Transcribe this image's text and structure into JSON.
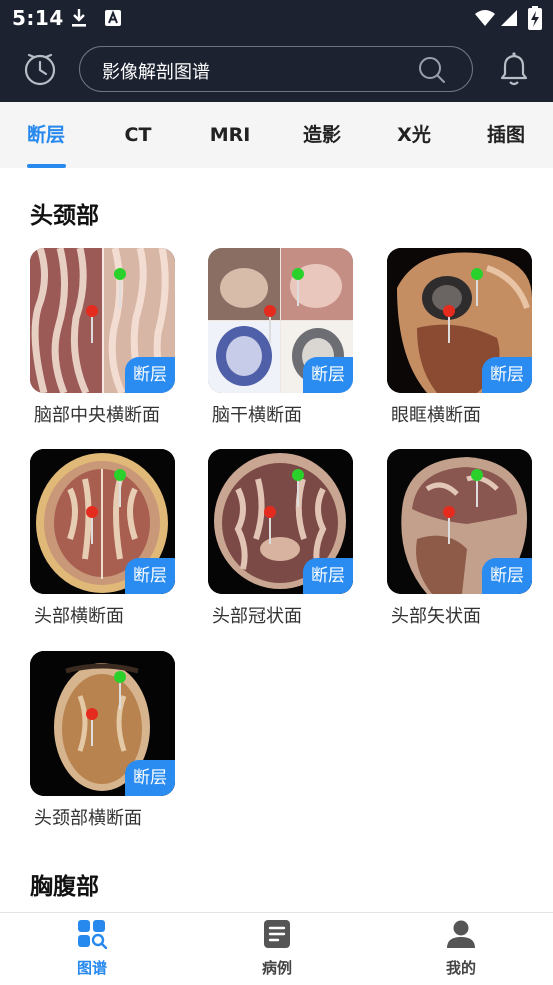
{
  "status_bar": {
    "time": "5:14"
  },
  "header": {
    "search_placeholder": "影像解剖图谱"
  },
  "tabs": [
    {
      "label": "断层",
      "active": true
    },
    {
      "label": "CT"
    },
    {
      "label": "MRI"
    },
    {
      "label": "造影"
    },
    {
      "label": "X光"
    },
    {
      "label": "插图"
    }
  ],
  "sections": [
    {
      "title": "头颈部",
      "items": [
        {
          "caption": "脑部中央横断面",
          "badge": "断层"
        },
        {
          "caption": "脑干横断面",
          "badge": "断层"
        },
        {
          "caption": "眼眶横断面",
          "badge": "断层"
        },
        {
          "caption": "头部横断面",
          "badge": "断层"
        },
        {
          "caption": "头部冠状面",
          "badge": "断层"
        },
        {
          "caption": "头部矢状面",
          "badge": "断层"
        },
        {
          "caption": "头颈部横断面",
          "badge": "断层"
        }
      ]
    },
    {
      "title": "胸腹部"
    }
  ],
  "bottom_nav": [
    {
      "label": "图谱",
      "icon": "atlas-icon",
      "active": true
    },
    {
      "label": "病例",
      "icon": "case-icon"
    },
    {
      "label": "我的",
      "icon": "profile-icon"
    }
  ],
  "colors": {
    "accent": "#2789ee",
    "header_bg": "#1c2230",
    "badge_bg": "#2a8cf1"
  }
}
